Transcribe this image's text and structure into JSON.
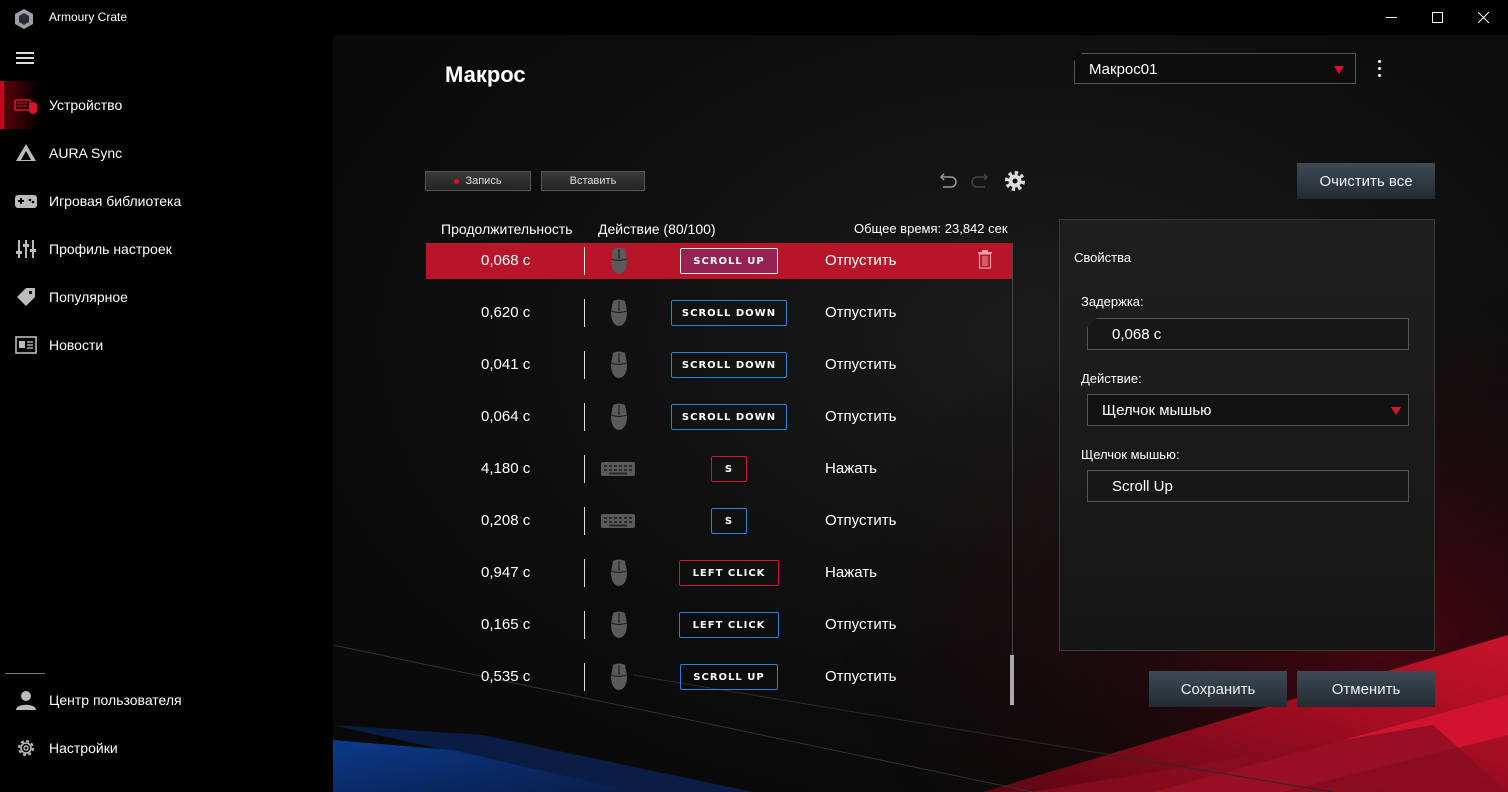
{
  "window": {
    "title": "Armoury Crate",
    "controls": {
      "minimize": "—",
      "maximize": "☐",
      "close": "✕"
    }
  },
  "sidebar": {
    "items": [
      {
        "label": "Устройство",
        "icon": "device-icon",
        "active": true
      },
      {
        "label": "AURA Sync",
        "icon": "aura-sync-icon",
        "active": false
      },
      {
        "label": "Игровая библиотека",
        "icon": "gamepad-icon",
        "active": false
      },
      {
        "label": "Профиль настроек",
        "icon": "sliders-icon",
        "active": false
      },
      {
        "label": "Популярное",
        "icon": "tag-icon",
        "active": false
      },
      {
        "label": "Новости",
        "icon": "news-icon",
        "active": false
      }
    ],
    "bottom_items": [
      {
        "label": "Центр пользователя",
        "icon": "user-icon"
      },
      {
        "label": "Настройки",
        "icon": "gear-icon"
      }
    ]
  },
  "page": {
    "title": "Макрос",
    "profile_select": {
      "value": "Макрос01"
    }
  },
  "toolbar": {
    "record_label": "Запись",
    "insert_label": "Вставить",
    "clear_all_label": "Очистить все"
  },
  "table": {
    "col_duration": "Продолжительность",
    "col_action": "Действие (80/100)",
    "total_time": "Общее время: 23,842 сек",
    "rows": [
      {
        "duration": "0,068 с",
        "device": "mouse",
        "key": "SCROLL UP",
        "key_color": "blue",
        "action": "Отпустить",
        "selected": true
      },
      {
        "duration": "0,620 с",
        "device": "mouse",
        "key": "SCROLL DOWN",
        "key_color": "blue",
        "action": "Отпустить",
        "selected": false
      },
      {
        "duration": "0,041 с",
        "device": "mouse",
        "key": "SCROLL DOWN",
        "key_color": "blue",
        "action": "Отпустить",
        "selected": false
      },
      {
        "duration": "0,064 с",
        "device": "mouse",
        "key": "SCROLL DOWN",
        "key_color": "blue",
        "action": "Отпустить",
        "selected": false
      },
      {
        "duration": "4,180 с",
        "device": "keyboard",
        "key": "S",
        "key_color": "red",
        "action": "Нажать",
        "selected": false
      },
      {
        "duration": "0,208 с",
        "device": "keyboard",
        "key": "S",
        "key_color": "blue",
        "action": "Отпустить",
        "selected": false
      },
      {
        "duration": "0,947 с",
        "device": "mouse",
        "key": "LEFT CLICK",
        "key_color": "red",
        "action": "Нажать",
        "selected": false
      },
      {
        "duration": "0,165 с",
        "device": "mouse",
        "key": "LEFT CLICK",
        "key_color": "blue",
        "action": "Отпустить",
        "selected": false
      },
      {
        "duration": "0,535 с",
        "device": "mouse",
        "key": "SCROLL UP",
        "key_color": "blue",
        "action": "Отпустить",
        "selected": false
      }
    ]
  },
  "properties": {
    "title": "Свойства",
    "delay_label": "Задержка:",
    "delay_value": "0,068 с",
    "action_label": "Действие:",
    "action_value": "Щелчок мышью",
    "click_label": "Щелчок мышью:",
    "click_value": "Scroll Up"
  },
  "footer": {
    "save_label": "Сохранить",
    "cancel_label": "Отменить"
  },
  "colors": {
    "accent_red": "#e0102a",
    "key_blue": "#2f7fe0",
    "selected_row": "#b8142a"
  }
}
